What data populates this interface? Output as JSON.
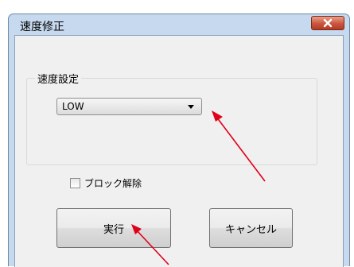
{
  "window": {
    "title": "速度修正"
  },
  "speed_group": {
    "label": "速度設定",
    "select_value": "LOW"
  },
  "block_release": {
    "label": "ブロック解除",
    "checked": false
  },
  "buttons": {
    "execute": "実行",
    "cancel": "キャンセル"
  },
  "colors": {
    "title_bar": "#c6d9ee",
    "close_button": "#c9563d",
    "annotation_arrow": "#e0001a"
  }
}
